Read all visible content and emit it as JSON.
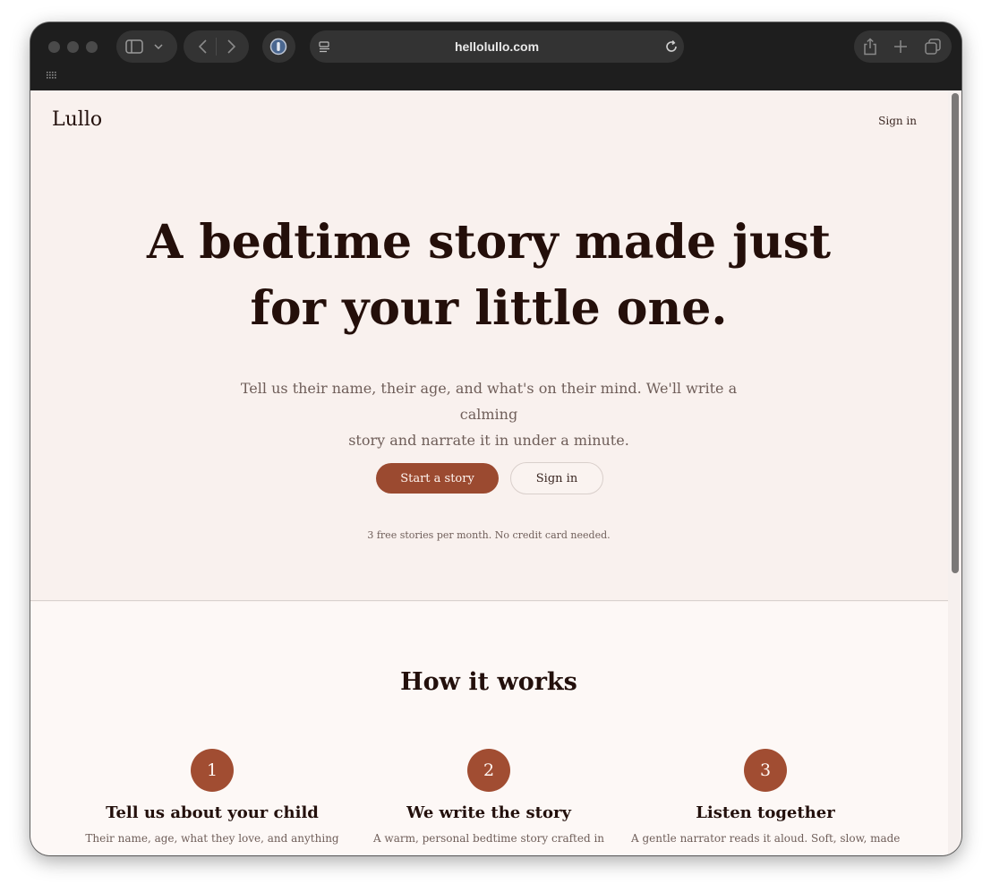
{
  "browser": {
    "url": "hellolullo.com"
  },
  "page": {
    "logo": "Lullo",
    "nav_signin": "Sign in",
    "hero": {
      "headline_line1": "A bedtime story made just",
      "headline_line2": "for your little one.",
      "subtitle_line1": "Tell us their name, their age, and what's on their mind. We'll write a calming",
      "subtitle_line2": "story and narrate it in under a minute.",
      "primary_button": "Start a story",
      "secondary_button": "Sign in",
      "fine_print": "3 free stories per month. No credit card needed."
    },
    "how_it_works": {
      "title": "How it works",
      "steps": [
        {
          "number": "1",
          "title": "Tell us about your child",
          "description": "Their name, age, what they love, and anything"
        },
        {
          "number": "2",
          "title": "We write the story",
          "description": "A warm, personal bedtime story crafted in"
        },
        {
          "number": "3",
          "title": "Listen together",
          "description": "A gentle narrator reads it aloud. Soft, slow, made"
        }
      ]
    }
  },
  "colors": {
    "accent": "#9b4a30",
    "background": "#f9f1ee",
    "text": "#240f0a"
  },
  "icons": [
    "sidebar-icon",
    "chevron-down-icon",
    "back-icon",
    "forward-icon",
    "extension-icon",
    "reader-icon",
    "reload-icon",
    "share-icon",
    "new-tab-icon",
    "tabs-overview-icon",
    "grid-icon"
  ]
}
